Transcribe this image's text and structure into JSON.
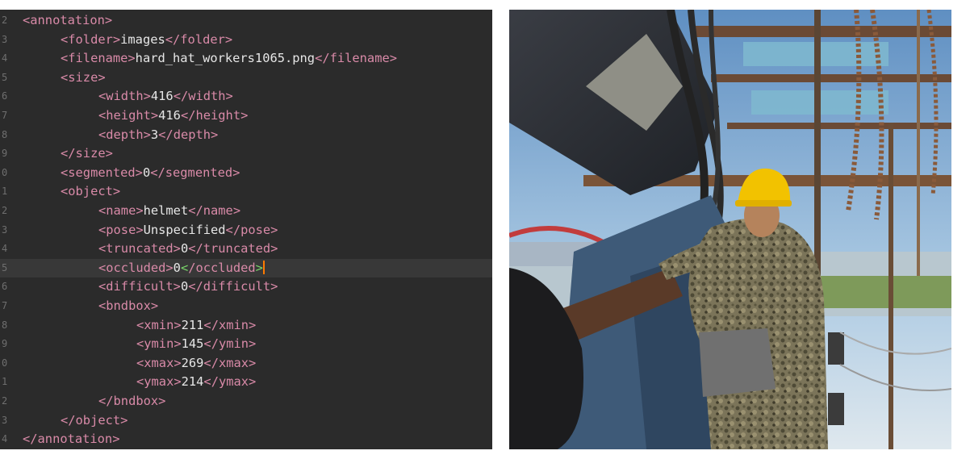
{
  "editor": {
    "lines": [
      {
        "num": "2",
        "indent": 0,
        "open": "<annotation>",
        "value": "",
        "close": ""
      },
      {
        "num": "3",
        "indent": 1,
        "open": "<folder>",
        "value": "images",
        "close": "</folder>"
      },
      {
        "num": "4",
        "indent": 1,
        "open": "<filename>",
        "value": "hard_hat_workers1065.png",
        "close": "</filename>"
      },
      {
        "num": "5",
        "indent": 1,
        "open": "<size>",
        "value": "",
        "close": ""
      },
      {
        "num": "6",
        "indent": 2,
        "open": "<width>",
        "value": "416",
        "close": "</width>"
      },
      {
        "num": "7",
        "indent": 2,
        "open": "<height>",
        "value": "416",
        "close": "</height>"
      },
      {
        "num": "8",
        "indent": 2,
        "open": "<depth>",
        "value": "3",
        "close": "</depth>"
      },
      {
        "num": "9",
        "indent": 1,
        "open": "</size>",
        "value": "",
        "close": ""
      },
      {
        "num": "0",
        "indent": 1,
        "open": "<segmented>",
        "value": "0",
        "close": "</segmented>"
      },
      {
        "num": "1",
        "indent": 1,
        "open": "<object>",
        "value": "",
        "close": ""
      },
      {
        "num": "2",
        "indent": 2,
        "open": "<name>",
        "value": "helmet",
        "close": "</name>"
      },
      {
        "num": "3",
        "indent": 2,
        "open": "<pose>",
        "value": "Unspecified",
        "close": "</pose>"
      },
      {
        "num": "4",
        "indent": 2,
        "open": "<truncated>",
        "value": "0",
        "close": "</truncated>"
      },
      {
        "num": "5",
        "indent": 2,
        "open": "<occluded>",
        "value": "0",
        "close": "</occluded>",
        "current": true
      },
      {
        "num": "6",
        "indent": 2,
        "open": "<difficult>",
        "value": "0",
        "close": "</difficult>"
      },
      {
        "num": "7",
        "indent": 2,
        "open": "<bndbox>",
        "value": "",
        "close": ""
      },
      {
        "num": "8",
        "indent": 3,
        "open": "<xmin>",
        "value": "211",
        "close": "</xmin>"
      },
      {
        "num": "9",
        "indent": 3,
        "open": "<ymin>",
        "value": "145",
        "close": "</ymin>"
      },
      {
        "num": "0",
        "indent": 3,
        "open": "<xmax>",
        "value": "269",
        "close": "</xmax>"
      },
      {
        "num": "1",
        "indent": 3,
        "open": "<ymax>",
        "value": "214",
        "close": "</ymax>"
      },
      {
        "num": "2",
        "indent": 2,
        "open": "</bndbox>",
        "value": "",
        "close": ""
      },
      {
        "num": "3",
        "indent": 1,
        "open": "</object>",
        "value": "",
        "close": ""
      },
      {
        "num": "4",
        "indent": 0,
        "open": "</annotation>",
        "value": "",
        "close": ""
      }
    ],
    "colors": {
      "background": "#2b2b2b",
      "tag": "#d98aa8",
      "text": "#e6e6e6",
      "bracket_match": "#7ad66a",
      "caret": "#ff7a00"
    }
  },
  "photo": {
    "subject": "worker-in-yellow-hard-hat",
    "colors": {
      "sky": "#8fb7d8",
      "helmet": "#f2c200",
      "uniform": "#6e6a4e"
    }
  }
}
